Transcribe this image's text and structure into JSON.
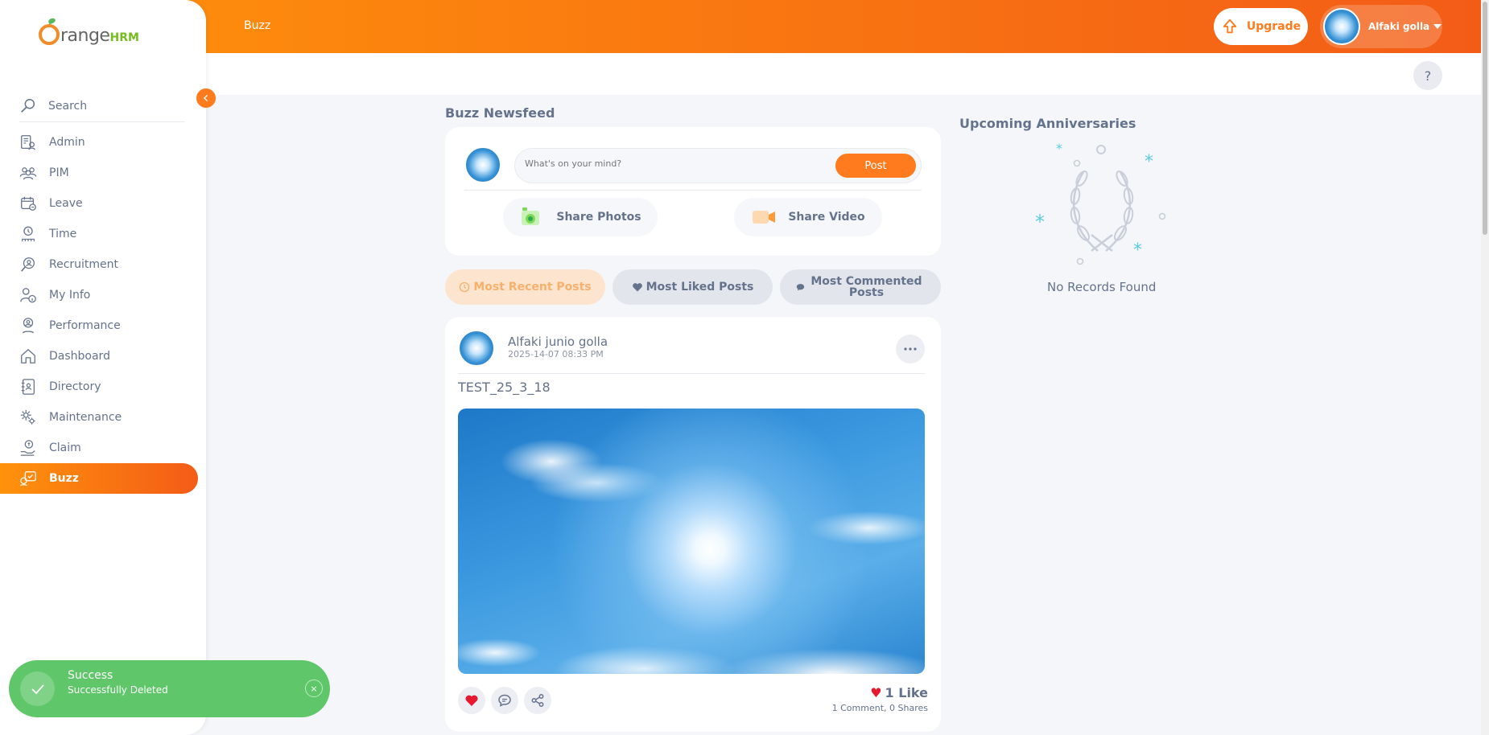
{
  "app": {
    "brand_main": "range",
    "brand_suffix": "HRM"
  },
  "topbar": {
    "title": "Buzz",
    "upgrade_label": "Upgrade",
    "user_name": "Alfaki golla",
    "help_label": "?"
  },
  "sidebar": {
    "search_placeholder": "Search",
    "items": [
      {
        "label": "Admin",
        "icon": "admin-icon"
      },
      {
        "label": "PIM",
        "icon": "pim-icon"
      },
      {
        "label": "Leave",
        "icon": "leave-icon"
      },
      {
        "label": "Time",
        "icon": "time-icon"
      },
      {
        "label": "Recruitment",
        "icon": "recruitment-icon"
      },
      {
        "label": "My Info",
        "icon": "my-info-icon"
      },
      {
        "label": "Performance",
        "icon": "performance-icon"
      },
      {
        "label": "Dashboard",
        "icon": "dashboard-icon"
      },
      {
        "label": "Directory",
        "icon": "directory-icon"
      },
      {
        "label": "Maintenance",
        "icon": "maintenance-icon"
      },
      {
        "label": "Claim",
        "icon": "claim-icon"
      },
      {
        "label": "Buzz",
        "icon": "buzz-icon",
        "active": true
      }
    ]
  },
  "feed": {
    "title": "Buzz Newsfeed",
    "composer": {
      "placeholder": "What's on your mind?",
      "post_label": "Post",
      "share_photos": "Share Photos",
      "share_video": "Share Video"
    },
    "tabs": {
      "recent": "Most Recent Posts",
      "liked": "Most Liked Posts",
      "commented": "Most Commented Posts"
    },
    "post": {
      "author": "Alfaki junio golla",
      "timestamp": "2025-14-07 08:33 PM",
      "text": "TEST_25_3_18",
      "likes": "1 Like",
      "comments": "1 Comment",
      "shares": "0 Shares"
    }
  },
  "anniversaries": {
    "title": "Upcoming Anniversaries",
    "empty": "No Records Found"
  },
  "toast": {
    "title": "Success",
    "message": "Successfully Deleted",
    "close": "×"
  },
  "colors": {
    "accent": "#ff7b1d",
    "success": "#5fc76a",
    "text": "#64728c"
  }
}
